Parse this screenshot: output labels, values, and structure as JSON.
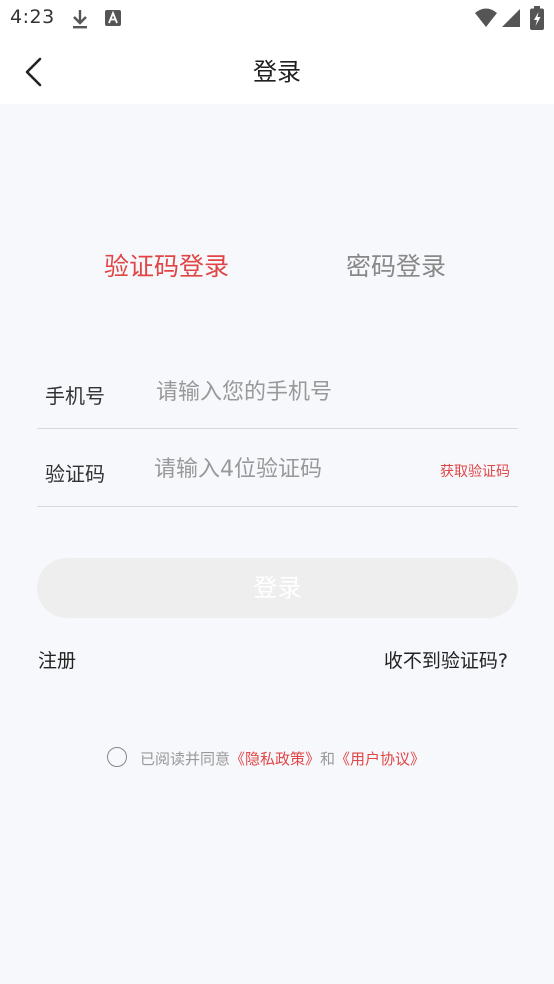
{
  "status_bar": {
    "time": "4:23",
    "icons": [
      "download-icon",
      "a-badge-icon",
      "wifi-icon",
      "signal-icon",
      "battery-charging-icon"
    ]
  },
  "header": {
    "title": "登录",
    "back_icon": "chevron-left-icon"
  },
  "tabs": {
    "sms_login": "验证码登录",
    "password_login": "密码登录",
    "active": "sms_login"
  },
  "form": {
    "phone_label": "手机号",
    "phone_placeholder": "请输入您的手机号",
    "phone_value": "",
    "code_label": "验证码",
    "code_placeholder": "请输入4位验证码",
    "code_value": "",
    "get_code_label": "获取验证码"
  },
  "actions": {
    "login_label": "登录",
    "register_label": "注册",
    "no_code_label": "收不到验证码?"
  },
  "agreement": {
    "prefix": "已阅读并同意",
    "privacy_link": "《隐私政策》",
    "and": "和",
    "user_link": "《用户协议》",
    "checked": false
  },
  "colors": {
    "accent": "#e04646",
    "button_disabled": "#eeeeee",
    "background": "#f7f8fc"
  }
}
